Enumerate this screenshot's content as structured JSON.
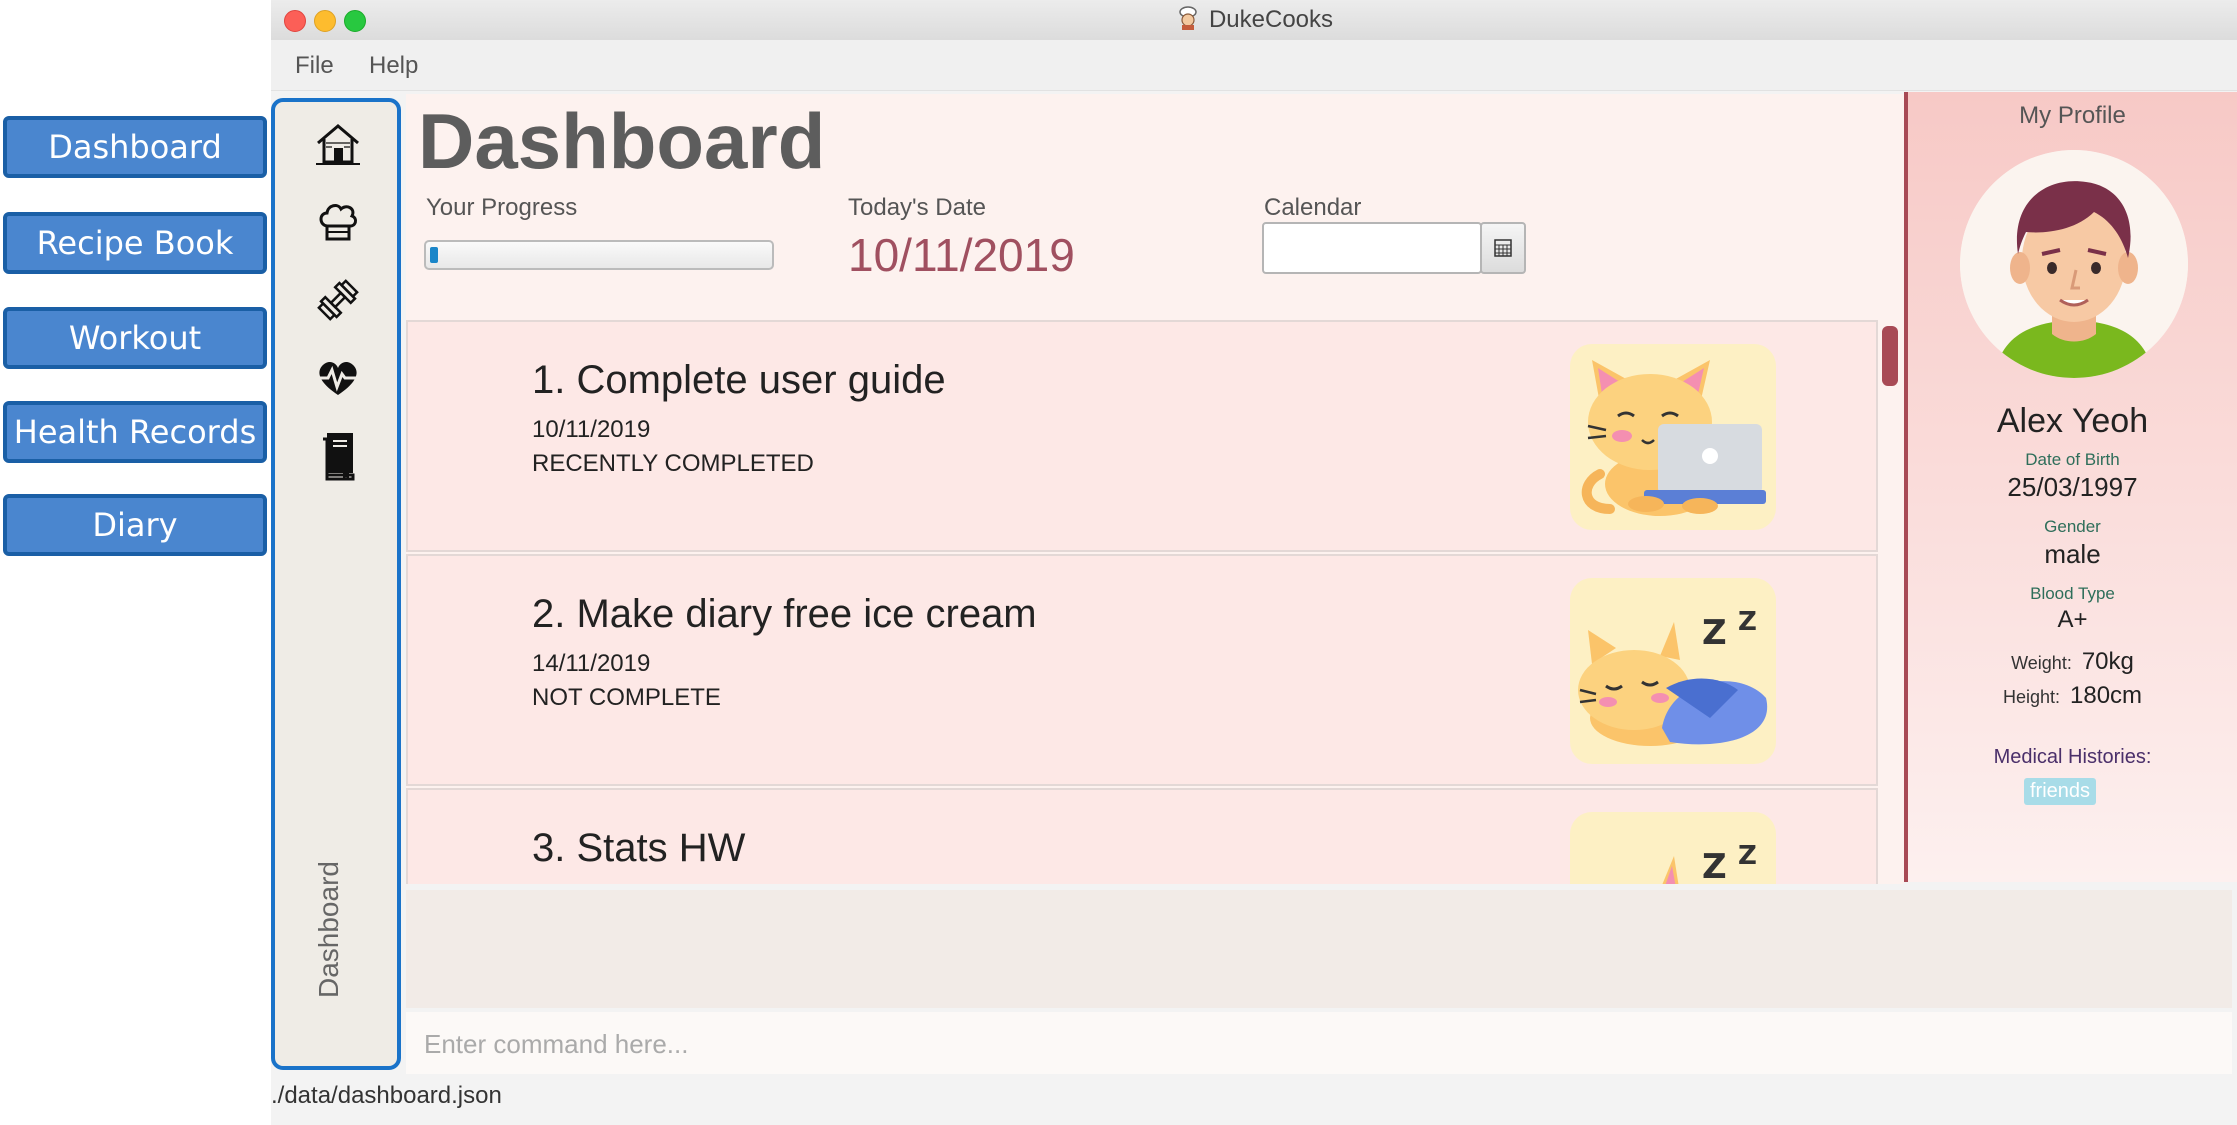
{
  "callouts": [
    "Dashboard",
    "Recipe Book",
    "Workout",
    "Health Records",
    "Diary"
  ],
  "window": {
    "title": "DukeCooks"
  },
  "menu": {
    "file": "File",
    "help": "Help"
  },
  "sidebar": {
    "items": [
      {
        "name": "home-icon"
      },
      {
        "name": "chef-hat-icon"
      },
      {
        "name": "dumbbell-icon"
      },
      {
        "name": "heartbeat-icon"
      },
      {
        "name": "diary-book-icon"
      }
    ],
    "current_page": "Dashboard"
  },
  "main": {
    "title": "Dashboard",
    "progress_label": "Your Progress",
    "progress_value": 0.02,
    "date_label": "Today's Date",
    "date_value": "10/11/2019",
    "calendar_label": "Calendar",
    "calendar_value": ""
  },
  "tasks": [
    {
      "title": "1.  Complete user guide",
      "date": "10/11/2019",
      "status": "RECENTLY COMPLETED",
      "icon": "cat-with-laptop"
    },
    {
      "title": "2.  Make diary free ice cream",
      "date": "14/11/2019",
      "status": "NOT COMPLETE",
      "icon": "sleeping-cat"
    },
    {
      "title": "3.  Stats HW",
      "date": "",
      "status": "",
      "icon": "sleeping-cat"
    }
  ],
  "profile": {
    "header": "My Profile",
    "name": "Alex Yeoh",
    "dob_label": "Date of Birth",
    "dob": "25/03/1997",
    "gender_label": "Gender",
    "gender": "male",
    "blood_label": "Blood Type",
    "blood": "A+",
    "weight_label": "Weight:",
    "weight": "70kg",
    "height_label": "Height:",
    "height": "180cm",
    "medical_label": "Medical Histories:",
    "medical_tags": [
      "friends"
    ]
  },
  "command": {
    "placeholder": "Enter command here...",
    "value": ""
  },
  "status_bar": {
    "path": "./data/dashboard.json"
  },
  "colors": {
    "accent": "#1a73c9",
    "callout": "#4a86cf",
    "card": "#fde8e6",
    "date": "#a05060",
    "profile_border": "#a84a55"
  }
}
